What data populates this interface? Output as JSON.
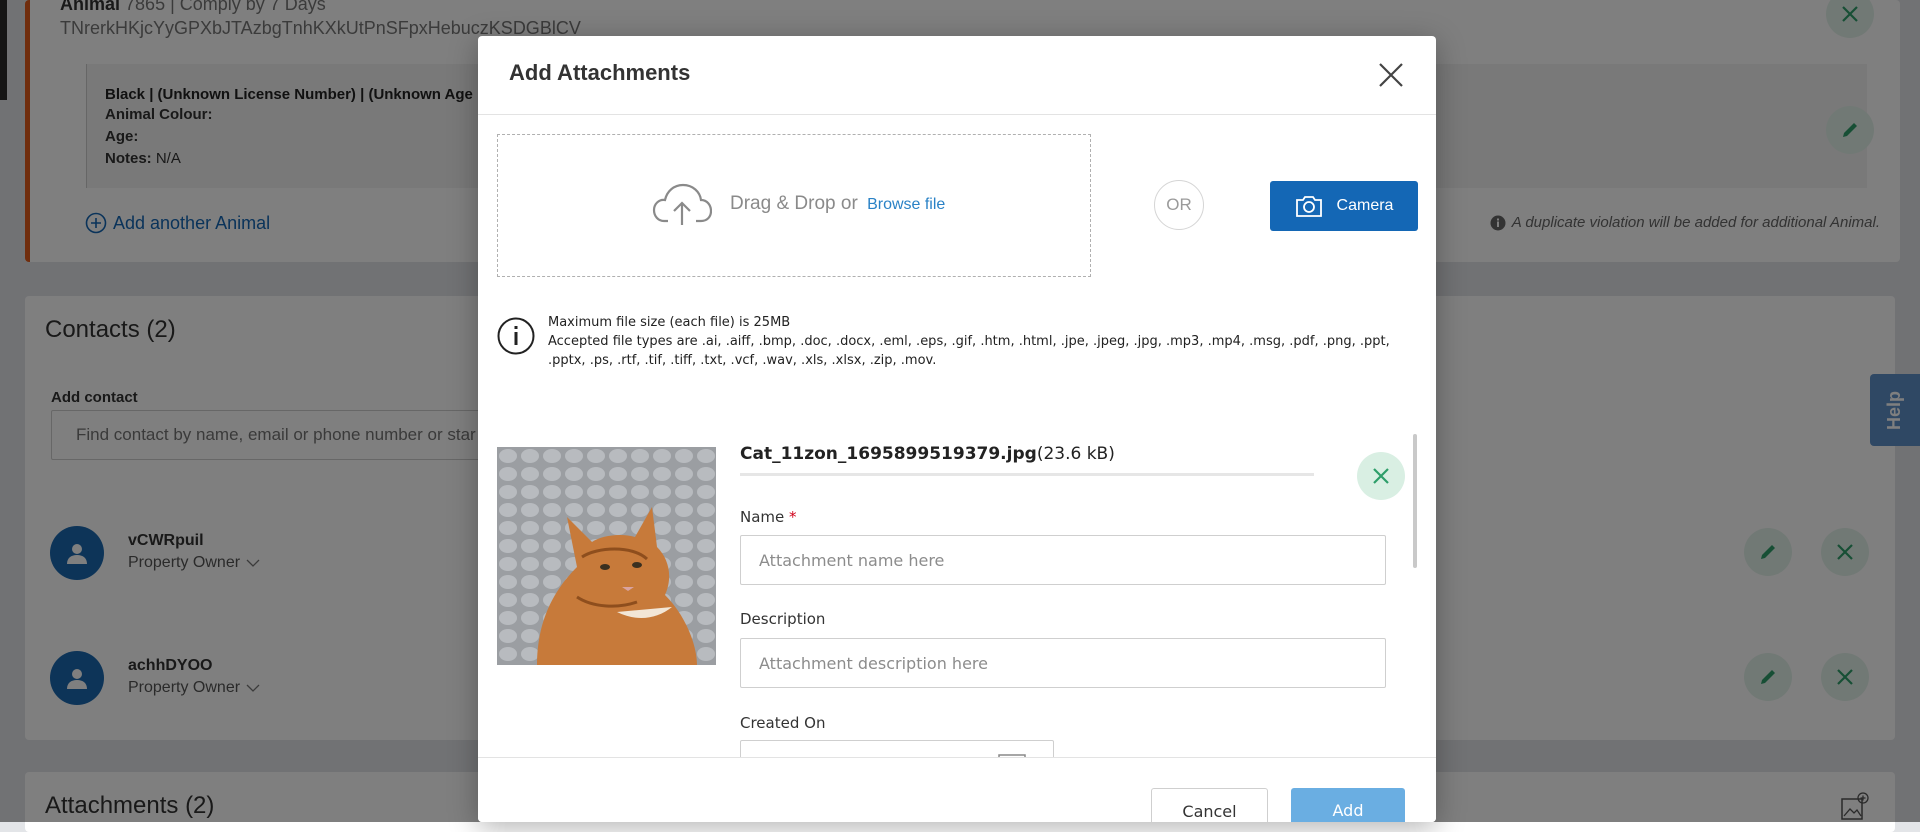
{
  "background": {
    "animal_title": "Animal",
    "animal_meta": "7865 | Comply by 7 Days",
    "animal_code": "TNrerkHKjcYyGPXbJTAzbgTnhKXkUtPnSFpxHebuczKSDGBlCV",
    "animal_summary": "Black | (Unknown License Number) | (Unknown Age",
    "animal_colour_label": "Animal Colour:",
    "age_label": "Age:",
    "notes_label": "Notes:",
    "notes_value": "N/A",
    "add_another_animal": "Add another Animal",
    "duplicate_notice": "A duplicate violation will be added for additional Animal.",
    "contacts_title": "Contacts (2)",
    "add_contact_label": "Add contact",
    "add_contact_placeholder": "Find contact by name, email or phone number or star",
    "contacts": [
      {
        "name": "vCWRpuil",
        "role": "Property Owner"
      },
      {
        "name": "achhDYOO",
        "role": "Property Owner"
      }
    ],
    "attachments_title": "Attachments (2)",
    "help_label": "Help"
  },
  "modal": {
    "title": "Add Attachments",
    "dropzone_text": "Drag & Drop or",
    "browse_link": "Browse file",
    "or_label": "OR",
    "camera_label": "Camera",
    "max_size_text": "Maximum file size (each file) is 25MB",
    "accepted_types_text": "Accepted file types are .ai, .aiff, .bmp, .doc, .docx, .eml, .eps, .gif, .htm, .html, .jpe, .jpeg, .jpg, .mp3, .mp4, .msg, .pdf, .png, .ppt, .pptx, .ps, .rtf, .tif, .tiff, .txt, .vcf, .wav, .xls, .xlsx, .zip, .mov.",
    "file": {
      "name": "Cat_11zon_1695899519379.jpg",
      "size": "(23.6 kB)"
    },
    "name_label": "Name",
    "required_mark": "*",
    "name_placeholder": "Attachment name here",
    "description_label": "Description",
    "description_placeholder": "Attachment description here",
    "created_on_label": "Created On",
    "cancel_label": "Cancel",
    "add_label": "Add"
  },
  "colors": {
    "primary": "#1467b5",
    "accent_orange": "#e05a1a",
    "add_disabled": "#6aaee2",
    "remove_green": "#2e9e6a"
  }
}
